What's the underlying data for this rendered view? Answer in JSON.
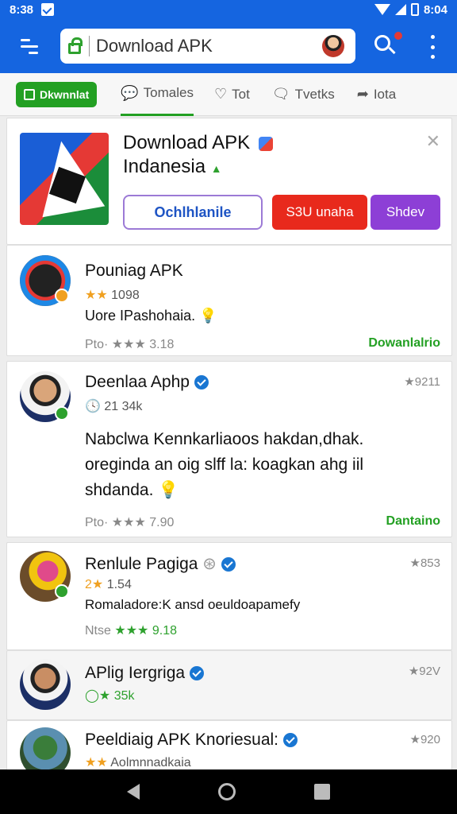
{
  "statusbar": {
    "time": "8:38",
    "right_time": "8:04"
  },
  "toolbar": {
    "search_text": "Download APK"
  },
  "tabs": [
    {
      "label": "Dkwnnlat"
    },
    {
      "label": "Tomales"
    },
    {
      "label": "Tot"
    },
    {
      "label": "Tvetks"
    },
    {
      "label": "Iota"
    }
  ],
  "hero": {
    "title": "Download APK",
    "subtitle": "Indanesia",
    "btn_outline": "Ochlhlanile",
    "btn_red": "S3U unaha",
    "btn_purple": "Shdev"
  },
  "rows": [
    {
      "name": "Pouniag APK",
      "meta": "1098",
      "stars": "★★",
      "desc": "Uore IPashohaia.",
      "footer_label": "Pto·",
      "footer_stars": "★★★",
      "footer_value": "3.18",
      "action": "Dowanlalrio"
    },
    {
      "name": "Deenlaa Aphp",
      "meta": "21 34k",
      "score": "★9211",
      "desc1": "Nabclwa Kennkarliaoos hakdan,dhak.",
      "desc2": "oreginda an oig slff la: koagkan ahg iil",
      "desc3": "shdanda.",
      "footer_label": "Pto·",
      "footer_stars": "★★★",
      "footer_value": "7.90",
      "action": "Dantaino"
    },
    {
      "name": "Renlule Pagiga",
      "meta": "1.54",
      "stars": "2★",
      "score": "★853",
      "desc": "Romaladore:K ansd oeuldoapamefy",
      "footer_label": "Ntse",
      "footer_stars": "★★★",
      "footer_value": "9.18"
    },
    {
      "name": "APlig Iergriga",
      "meta": "35k",
      "score": "★92V"
    },
    {
      "name": "Peeldiaig APK Knoriesual:",
      "meta": "Aolmnnadkaia",
      "score": "★920"
    }
  ],
  "colors": {
    "accent": "#1565e0",
    "green": "#23a023",
    "red": "#e8291c",
    "purple": "#8d3fd6"
  }
}
